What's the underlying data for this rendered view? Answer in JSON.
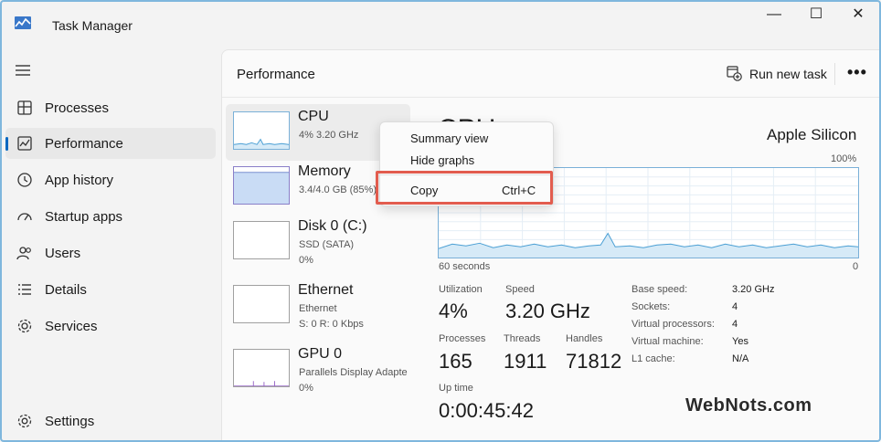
{
  "window": {
    "title": "Task Manager",
    "minimize": "—",
    "maximize": "☐",
    "close": "✕"
  },
  "sidebar": {
    "items": [
      {
        "label": "Processes"
      },
      {
        "label": "Performance"
      },
      {
        "label": "App history"
      },
      {
        "label": "Startup apps"
      },
      {
        "label": "Users"
      },
      {
        "label": "Details"
      },
      {
        "label": "Services"
      }
    ],
    "settings": "Settings"
  },
  "header": {
    "title": "Performance",
    "run_new_task": "Run new task",
    "more": "•••"
  },
  "devices": [
    {
      "name": "CPU",
      "sub": "4%  3.20 GHz",
      "sub2": ""
    },
    {
      "name": "Memory",
      "sub": "3.4/4.0 GB (85%)",
      "sub2": ""
    },
    {
      "name": "Disk 0 (C:)",
      "sub": "SSD (SATA)",
      "sub2": "0%"
    },
    {
      "name": "Ethernet",
      "sub": "Ethernet",
      "sub2": "S: 0  R: 0 Kbps"
    },
    {
      "name": "GPU 0",
      "sub": "Parallels Display Adapte",
      "sub2": "0%"
    }
  ],
  "detail": {
    "title": "CPU",
    "brand": "Apple Silicon",
    "pct_top": "100%",
    "axis_left": "60 seconds",
    "axis_right": "0",
    "utilization_label": "Utilization",
    "utilization": "4%",
    "speed_label": "Speed",
    "speed": "3.20 GHz",
    "processes_label": "Processes",
    "processes": "165",
    "threads_label": "Threads",
    "threads": "1911",
    "handles_label": "Handles",
    "handles": "71812",
    "uptime_label": "Up time",
    "uptime": "0:00:45:42",
    "specs": [
      {
        "label": "Base speed:",
        "value": "3.20 GHz"
      },
      {
        "label": "Sockets:",
        "value": "4"
      },
      {
        "label": "Virtual processors:",
        "value": "4"
      },
      {
        "label": "Virtual machine:",
        "value": "Yes"
      },
      {
        "label": "L1 cache:",
        "value": "N/A"
      }
    ]
  },
  "context_menu": {
    "summary_view": "Summary view",
    "hide_graphs": "Hide graphs",
    "copy": "Copy",
    "copy_shortcut": "Ctrl+C"
  },
  "watermark": "WebNots.com",
  "colors": {
    "accent": "#0067c0",
    "graph_line": "#4a9fd4",
    "graph_fill": "#d6eaf7",
    "highlight": "#e25c4e"
  }
}
